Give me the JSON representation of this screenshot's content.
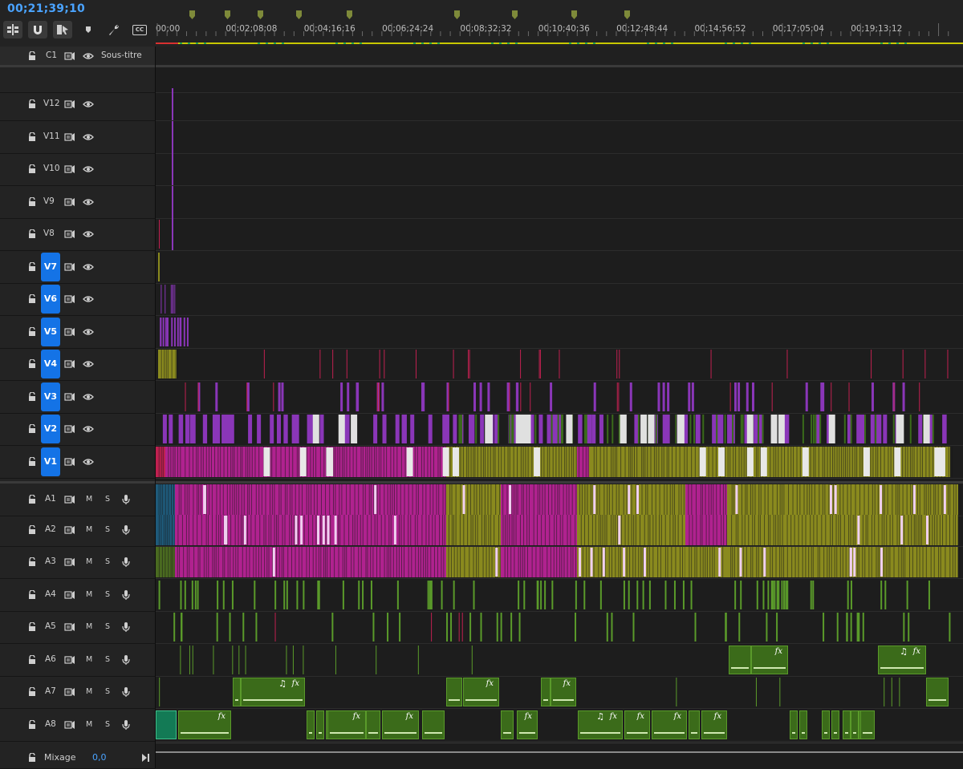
{
  "timeline": {
    "timecode": "00;21;39;10",
    "ruler_ticks": [
      "00;00",
      "00;02;08;08",
      "00;04;16;16",
      "00;06;24;24",
      "00;08;32;32",
      "00;10;40;36",
      "00;12;48;44",
      "00;14;56;52",
      "00;17;05;04",
      "00;19;13;12"
    ],
    "total_seconds": 1299,
    "ruler_seconds": [
      0,
      128,
      256,
      384,
      512,
      640,
      768,
      896,
      1024,
      1152
    ],
    "marker_seconds": [
      56,
      115,
      168,
      231,
      314,
      491,
      585,
      682,
      769
    ]
  },
  "toolbar": {
    "insert_icon": "insert-track-icon",
    "snap_icon": "magnet-snap-icon",
    "linked_icon": "linked-selection-icon",
    "marker_icon": "add-marker-icon",
    "settings_icon": "wrench-icon",
    "cc_label": "CC"
  },
  "caption_track": {
    "name": "C1",
    "label": "Sous-titre"
  },
  "video_tracks": [
    {
      "name": "V12",
      "target": false
    },
    {
      "name": "V11",
      "target": false
    },
    {
      "name": "V10",
      "target": false
    },
    {
      "name": "V9",
      "target": false
    },
    {
      "name": "V8",
      "target": false
    },
    {
      "name": "V7",
      "target": true
    },
    {
      "name": "V6",
      "target": true
    },
    {
      "name": "V5",
      "target": true
    },
    {
      "name": "V4",
      "target": true
    },
    {
      "name": "V3",
      "target": true
    },
    {
      "name": "V2",
      "target": true
    },
    {
      "name": "V1",
      "target": true
    }
  ],
  "audio_tracks": [
    {
      "name": "A1",
      "m": "M",
      "s": "S"
    },
    {
      "name": "A2",
      "m": "M",
      "s": "S"
    },
    {
      "name": "A3",
      "m": "M",
      "s": "S"
    },
    {
      "name": "A4",
      "m": "M",
      "s": "S"
    },
    {
      "name": "A5",
      "m": "M",
      "s": "S"
    },
    {
      "name": "A6",
      "m": "M",
      "s": "S"
    },
    {
      "name": "A7",
      "m": "M",
      "s": "S"
    },
    {
      "name": "A8",
      "m": "M",
      "s": "S"
    }
  ],
  "mix": {
    "label": "Mixage",
    "value": "0,0"
  },
  "clip_labels": {
    "fx": "fx",
    "music": "♫"
  },
  "colors": {
    "accent": "#1473e6",
    "timecode": "#4aa3ff",
    "magenta": "#b0228f",
    "olive": "#8a8a1e",
    "violet": "#8a36b8",
    "green": "#3b6b1a",
    "green_light": "#5a9a2a",
    "teal": "#137a55",
    "cyan": "#2a8fb8",
    "crimson": "#c02050",
    "work_area": "#c8c800"
  }
}
